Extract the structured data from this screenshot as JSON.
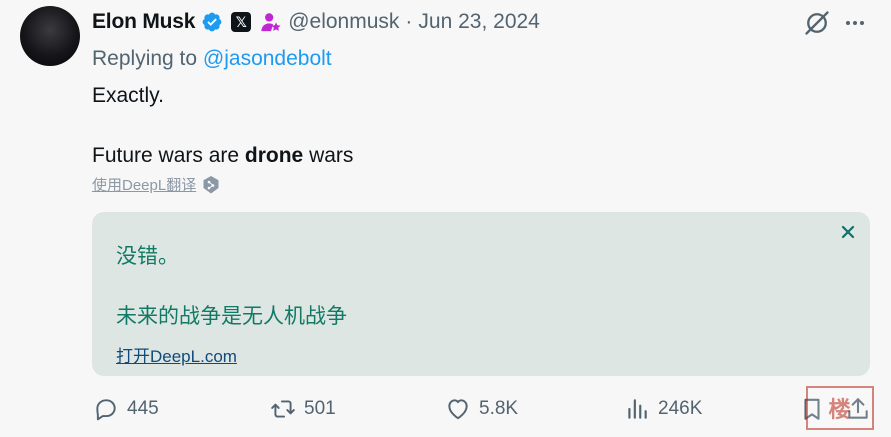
{
  "author": {
    "name": "Elon Musk",
    "handle": "@elonmusk",
    "separator": "·",
    "date": "Jun 23, 2024",
    "x_badge": "𝕏"
  },
  "reply": {
    "prefix": "Replying to",
    "to": "@jasondebolt"
  },
  "tweet": {
    "line1": "Exactly.",
    "line2_before": "Future wars are ",
    "line2_bold": "drone",
    "line2_after": " wars"
  },
  "translate_link": "使用DeepL翻译",
  "translation": {
    "line1": "没错。",
    "line2": "未来的战争是无人机战争",
    "open_link": "打开DeepL.com"
  },
  "stats": {
    "replies": "445",
    "reposts": "501",
    "likes": "5.8K",
    "views": "246K"
  },
  "watermark": "楼",
  "colors": {
    "verified": "#1d9bf0",
    "handle": "#536471",
    "link": "#1d9bf0",
    "translation_bg": "#dde6e3",
    "translation_text": "#117a65",
    "affiliate": "#c026d3"
  },
  "icons": [
    "verified-icon",
    "x-badge-icon",
    "affiliate-icon",
    "grok-icon",
    "more-icon",
    "deepl-icon",
    "close-icon",
    "reply-icon",
    "repost-icon",
    "like-icon",
    "views-icon",
    "bookmark-icon",
    "share-icon"
  ]
}
